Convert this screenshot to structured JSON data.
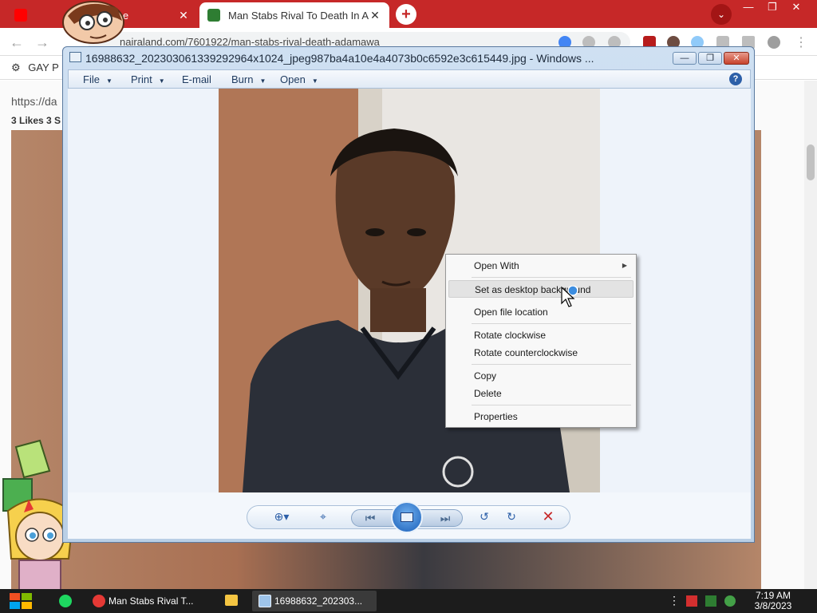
{
  "browser": {
    "tabs": [
      {
        "title": "YouTube",
        "close": "✕"
      },
      {
        "title": "Man Stabs Rival To Death In A",
        "close": "✕"
      }
    ],
    "new_tab": "+",
    "tab_search": "⌄",
    "window_controls": [
      "—",
      "❐",
      "✕"
    ],
    "address": "nairaland.com/7601922/man-stabs-rival-death-adamawa",
    "bookmark": "GAY P",
    "page_url_text": "https://da",
    "page_likes_text": "3 Likes 3 S"
  },
  "photo_viewer": {
    "title": "16988632_202303061339292964x1024_jpeg987ba4a10e4a4073b0c6592e3c615449.jpg - Windows ...",
    "controls": {
      "minimize": "—",
      "maximize": "❐",
      "close": "✕"
    },
    "menu": [
      {
        "label": "File",
        "caret": "▼"
      },
      {
        "label": "Print",
        "caret": "▼"
      },
      {
        "label": "E-mail",
        "caret": ""
      },
      {
        "label": "Burn",
        "caret": "▼"
      },
      {
        "label": "Open",
        "caret": "▼"
      }
    ],
    "help": "?",
    "bottom_controls": {
      "zoom": "⊕▾",
      "fit": "⌖",
      "previous": "⏮",
      "next": "⏭",
      "rotate_ccw": "↺",
      "rotate_cw": "↻",
      "delete": "✕"
    }
  },
  "context_menu": {
    "items": [
      {
        "label": "Open With",
        "submenu": "▶"
      },
      {
        "label": "Set as desktop background"
      },
      {
        "label": "Open file location"
      },
      {
        "label": "Rotate clockwise"
      },
      {
        "label": "Rotate counterclockwise"
      },
      {
        "label": "Copy"
      },
      {
        "label": "Delete"
      },
      {
        "label": "Properties"
      }
    ]
  },
  "taskbar": {
    "apps": [
      {
        "label": "Man Stabs Rival T..."
      },
      {
        "label": "16988632_202303..."
      }
    ],
    "clock": {
      "time": "7:19 AM",
      "date": "3/8/2023"
    }
  },
  "colors": {
    "chrome_red": "#c62828",
    "photo_viewer_frame": "#b9cfe6",
    "taskbar": "#1c1c1c"
  }
}
